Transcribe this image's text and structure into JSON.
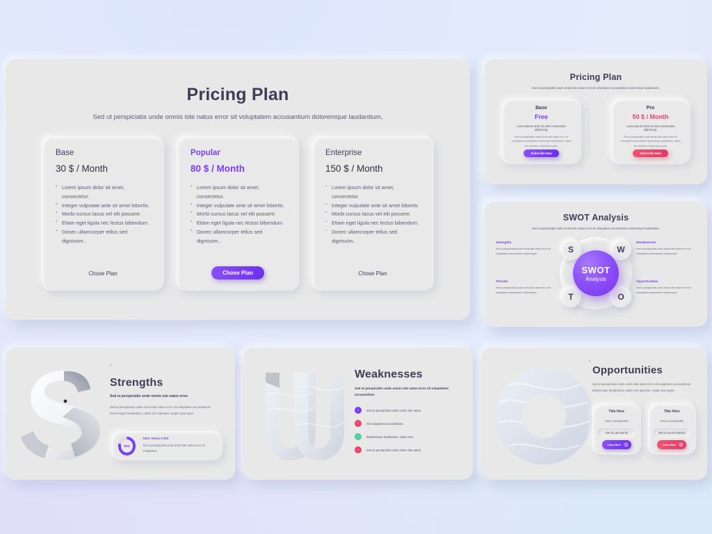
{
  "main_pricing": {
    "title": "Pricing Plan",
    "tagline": "Sed ut perspiciatis unde omnis iste natus error sit voluptatem accusantium doloremque laudantium,",
    "plans": [
      {
        "name": "Base",
        "price": "30 $ / Month",
        "features": [
          "Lorem ipsum dolor sit amet, consectetur.",
          "Integer vulputate ante sit amet lobortis.",
          "Morbi cursus lacus vel elit posuere.",
          "Etiam eget ligula nec lectus bibendum.",
          "Donec ullamcorper tellus sed dignissim.."
        ],
        "cta": "Chose Plan",
        "featured": false
      },
      {
        "name": "Popular",
        "price": "80 $ / Month",
        "features": [
          "Lorem ipsum dolor sit amet, consectetur.",
          "Integer vulputate ante sit amet lobortis.",
          "Morbi cursus lacus vel elit posuere.",
          "Etiam eget ligula nec lectus bibendum.",
          "Donec ullamcorper tellus sed dignissim.."
        ],
        "cta": "Chose Plan",
        "featured": true
      },
      {
        "name": "Enterprise",
        "price": "150 $ / Month",
        "features": [
          "Lorem ipsum dolor sit amet, consectetur.",
          "Integer vulputate ante sit amet lobortis.",
          "Morbi cursus lacus vel elit posuere.",
          "Etiam eget ligula nec lectus bibendum.",
          "Donec ullamcorper tellus sed dignissim.."
        ],
        "cta": "Chose Plan",
        "featured": false
      }
    ]
  },
  "mini_pricing": {
    "title": "Pricing Plan",
    "tagline": "Sed ut perspiciatis unde omnis iste natus error sit voluptatem accusantium doloremque laudantium.",
    "plans": [
      {
        "name": "Base",
        "price": "Free",
        "lead": "Lorem ipsum dolor sit amet consectetu adipiscing.",
        "body": "Sed ut perspiciatis unde omnis iste natus error sit voluptatem accusantium doloremque laudantium, totam rem aperiam, eaque ipsa quae.",
        "cta": "Subscribe Now",
        "accent": "#7b3ff2"
      },
      {
        "name": "Pro",
        "price": "50 $ / Month",
        "lead": "Lorem ipsum dolor sit amet consectetu adipiscing.",
        "body": "Sed ut perspiciatis unde omnis iste natus error sit voluptatem accusantium doloremque laudantium, totam rem aperiam, eaque ipsa quae.",
        "cta": "Subscribe Now",
        "accent": "#e8446b"
      }
    ]
  },
  "swot": {
    "title": "SWOT Analysis",
    "tagline": "Sed ut perspiciatis unde omnis iste natus error sit voluptatem accusantium doloremque laudantium.",
    "center_line1": "SWOT",
    "center_line2": "Analysis",
    "nodes": [
      {
        "letter": "S",
        "position": "top-left"
      },
      {
        "letter": "W",
        "position": "top-right"
      },
      {
        "letter": "T",
        "position": "bottom-left"
      },
      {
        "letter": "O",
        "position": "bottom-right"
      }
    ],
    "captions": [
      {
        "title": "Strengths",
        "desc": "Sed ut perspiciatis unde omnis iste natus error sit voluptatem accusantium doloremque."
      },
      {
        "title": "Weaknesses",
        "desc": "Sed ut perspiciatis unde omnis iste natus error sit voluptatem accusantium doloremque."
      },
      {
        "title": "Threats",
        "desc": "Sed ut perspiciatis unde omnis iste natus error sit voluptatem accusantium doloremque."
      },
      {
        "title": "Opportunities",
        "desc": "Sed ut perspiciatis unde omnis iste natus error sit voluptatem accusantium doloremque."
      }
    ],
    "accent": "#7b3ff2"
  },
  "strengths": {
    "letter": "S",
    "title": "Strengths",
    "lead": "Sed ut perspiciatis unde omnis iste natus error.",
    "body": "Sed ut perspiciatis unde omnis iste natus error sit voluptatem accusantium doloremque laudantium, totam rem aperiam, eaque ipsa quae.",
    "seo_title": "SEO ANALYSIS",
    "seo_desc": "Sed ut perspiciatis unde omnis iste natus error sit voluptatem.",
    "seo_percent": "80%",
    "seo_value": 80,
    "accent": "#7b3ff2"
  },
  "weaknesses": {
    "letter": "W",
    "title": "Weaknesses",
    "lead": "Sed ut perspiciatis unde omnis iste natus error sit voluptatem accusantium.",
    "items": [
      {
        "text": "Sed ut perspiciatis unde omnis iste natus",
        "color": "#7b3ff2"
      },
      {
        "text": "Sit voluptatem accusantium.",
        "color": "#e8446b"
      },
      {
        "text": "Dolaremque laudantium, totam rem.",
        "color": "#4ecfa0"
      },
      {
        "text": "Sed ut perspiciatis unde omnis iste natus",
        "color": "#e8446b"
      }
    ]
  },
  "opportunities": {
    "shape": "donut",
    "title": "Opportunities",
    "body": "Sed ut perspiciatis unde omnis iste natus error sit voluptatem accusantium doloremque laudantium, totam rem aperiam, eaque ipsa quae.",
    "cards": [
      {
        "title": "Title Here",
        "desc": "Sed ut perspiciatis",
        "value": "20K $ Last Month",
        "cta": "Learn More",
        "accent": "#7b3ff2"
      },
      {
        "title": "Title Here",
        "desc": "Sed ut perspiciatis",
        "value": "20K $ Current Month",
        "cta": "Learn More",
        "accent": "#e8446b"
      }
    ]
  }
}
